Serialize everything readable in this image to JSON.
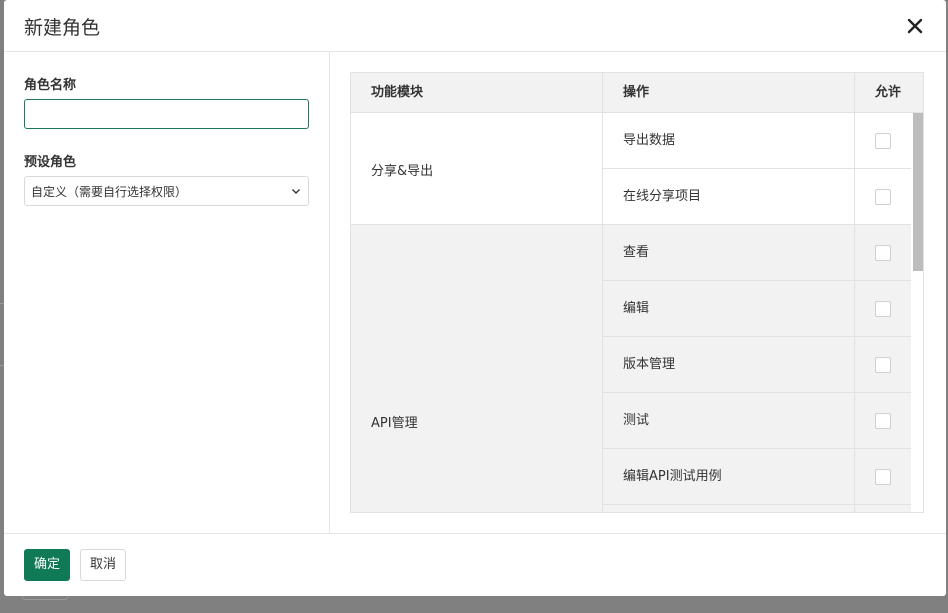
{
  "modal": {
    "title": "新建角色"
  },
  "form": {
    "name_label": "角色名称",
    "name_value": "",
    "preset_label": "预设角色",
    "preset_value": "自定义（需要自行选择权限）"
  },
  "table": {
    "headers": {
      "module": "功能模块",
      "operation": "操作",
      "allow": "允许"
    },
    "groups": [
      {
        "module": "分享&导出",
        "ops": [
          "导出数据",
          "在线分享项目"
        ]
      },
      {
        "module": "API管理",
        "ops": [
          "查看",
          "编辑",
          "版本管理",
          "测试",
          "编辑API测试用例"
        ]
      }
    ]
  },
  "footer": {
    "confirm_label": "确定",
    "cancel_label": "取消"
  },
  "colors": {
    "primary": "#0f7a55",
    "input_focus_border": "#1e7a56",
    "shaded_row": "#f2f2f2"
  },
  "icons": {
    "close": "close-icon",
    "dropdown": "chevron-down-icon"
  }
}
